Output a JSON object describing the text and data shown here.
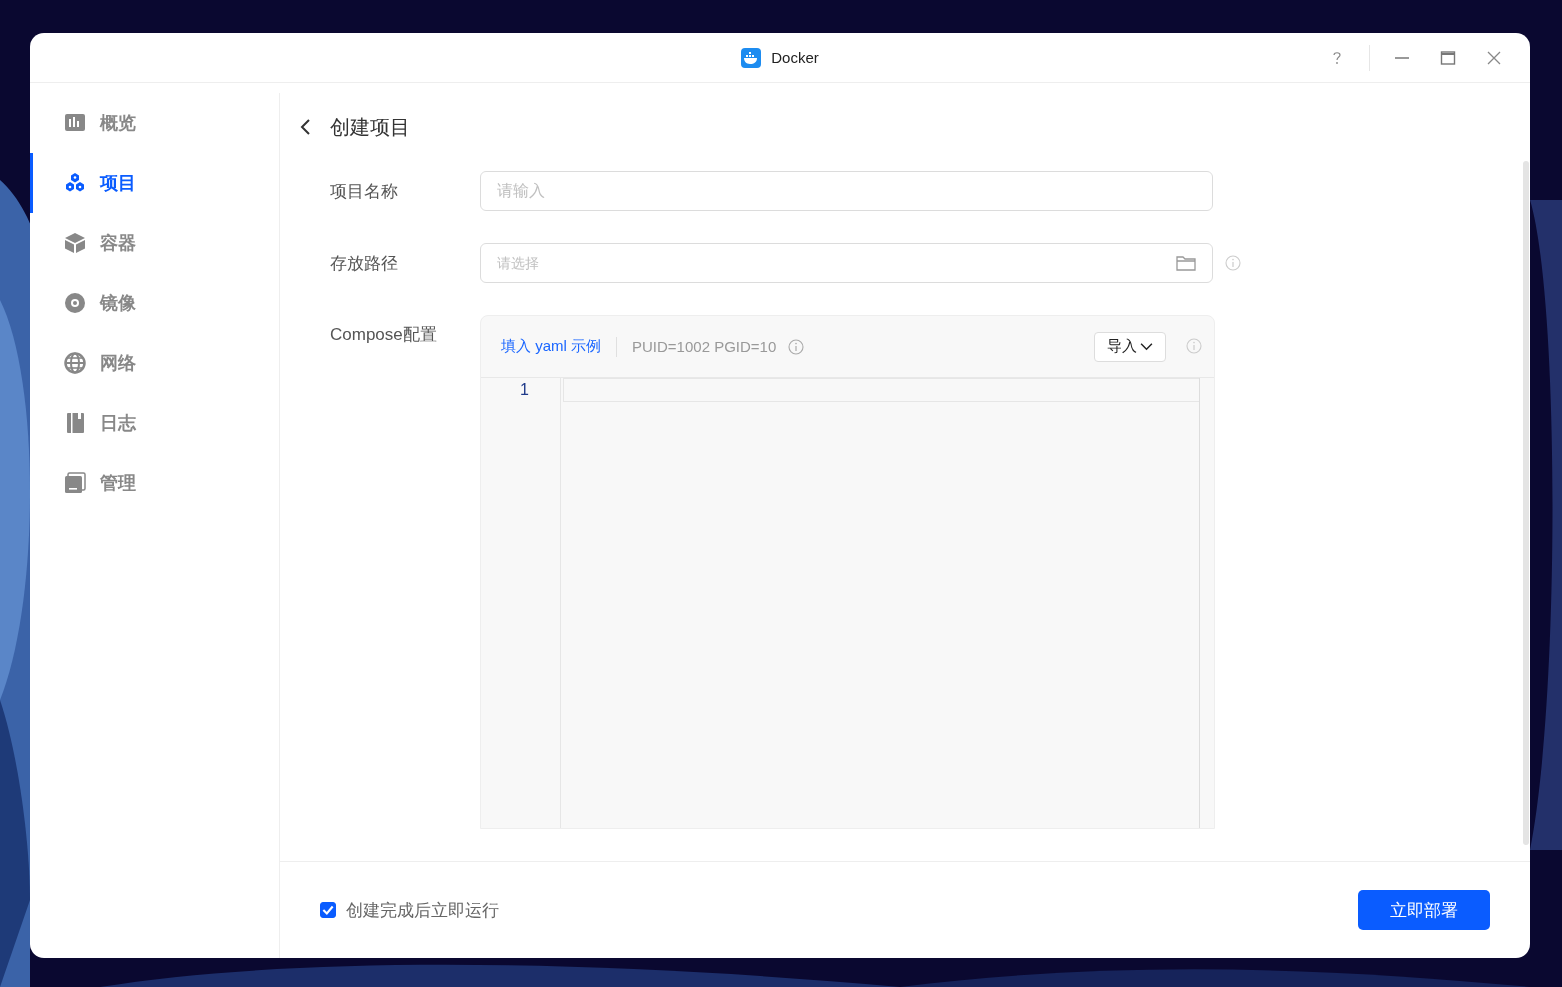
{
  "window": {
    "title": "Docker"
  },
  "sidebar": {
    "items": [
      {
        "label": "概览",
        "kind": "overview",
        "selected": false
      },
      {
        "label": "项目",
        "kind": "project",
        "selected": true
      },
      {
        "label": "容器",
        "kind": "container",
        "selected": false
      },
      {
        "label": "镜像",
        "selected": false
      },
      {
        "label": "网络",
        "kind": "network",
        "selected": false
      },
      {
        "label": "日志",
        "kind": "log",
        "selected": false
      },
      {
        "label": "管理",
        "kind": "manage",
        "selected": false
      }
    ]
  },
  "page": {
    "title": "创建项目"
  },
  "form": {
    "name": {
      "label": "项目名称",
      "placeholder": "请输入"
    },
    "path": {
      "label": "存放路径",
      "placeholder": "请选择"
    },
    "compose": {
      "label": "Compose配置",
      "example_link": "填入 yaml 示例",
      "ids": "PUID=1002 PGID=10",
      "import_button": "导入",
      "line_numbers": [
        "1"
      ]
    }
  },
  "footer": {
    "run_after_create": {
      "label": "创建完成后立即运行",
      "checked": true
    },
    "deploy_button": "立即部署"
  }
}
